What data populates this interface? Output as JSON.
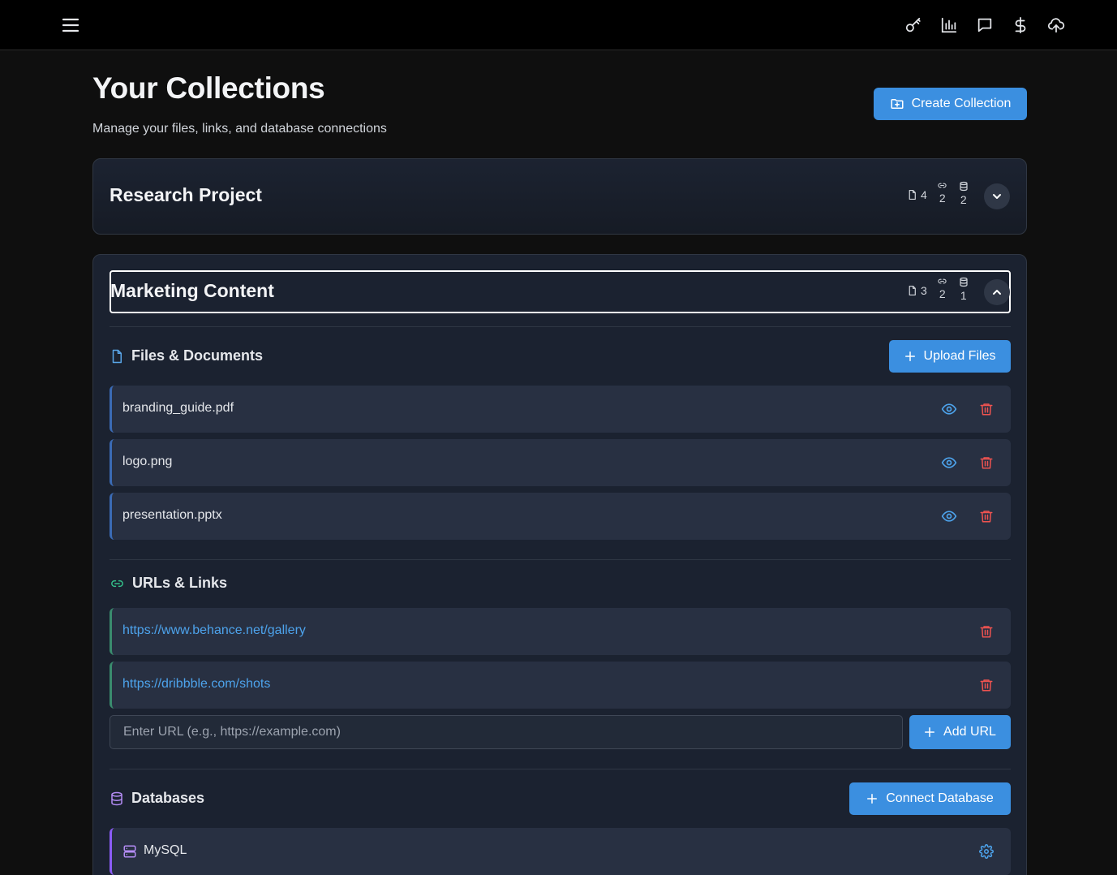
{
  "header": {
    "icons": [
      "menu-icon",
      "key-icon",
      "chart-icon",
      "message-icon",
      "dollar-icon",
      "cloud-upload-icon"
    ]
  },
  "page": {
    "title": "Your Collections",
    "subtitle": "Manage your files, links, and database connections",
    "create_label": "Create Collection"
  },
  "collections": [
    {
      "name": "Research Project",
      "files": "4",
      "links": "2",
      "databases": "2",
      "expanded": false
    },
    {
      "name": "Marketing Content",
      "files": "3",
      "links": "2",
      "databases": "1",
      "expanded": true,
      "files_section": {
        "title": "Files & Documents",
        "upload_label": "Upload Files",
        "items": [
          "branding_guide.pdf",
          "logo.png",
          "presentation.pptx"
        ]
      },
      "urls_section": {
        "title": "URLs & Links",
        "items": [
          "https://www.behance.net/gallery",
          "https://dribbble.com/shots"
        ],
        "input_placeholder": "Enter URL (e.g., https://example.com)",
        "add_label": "Add URL"
      },
      "db_section": {
        "title": "Databases",
        "connect_label": "Connect Database",
        "items": [
          "MySQL"
        ]
      }
    }
  ],
  "colors": {
    "accent": "#3b8fe0",
    "danger": "#ef5350",
    "link": "#4da3ec",
    "files_accent": "#3b6bb5",
    "urls_accent": "#3a8c6e",
    "db_accent": "#8b5cf6"
  }
}
